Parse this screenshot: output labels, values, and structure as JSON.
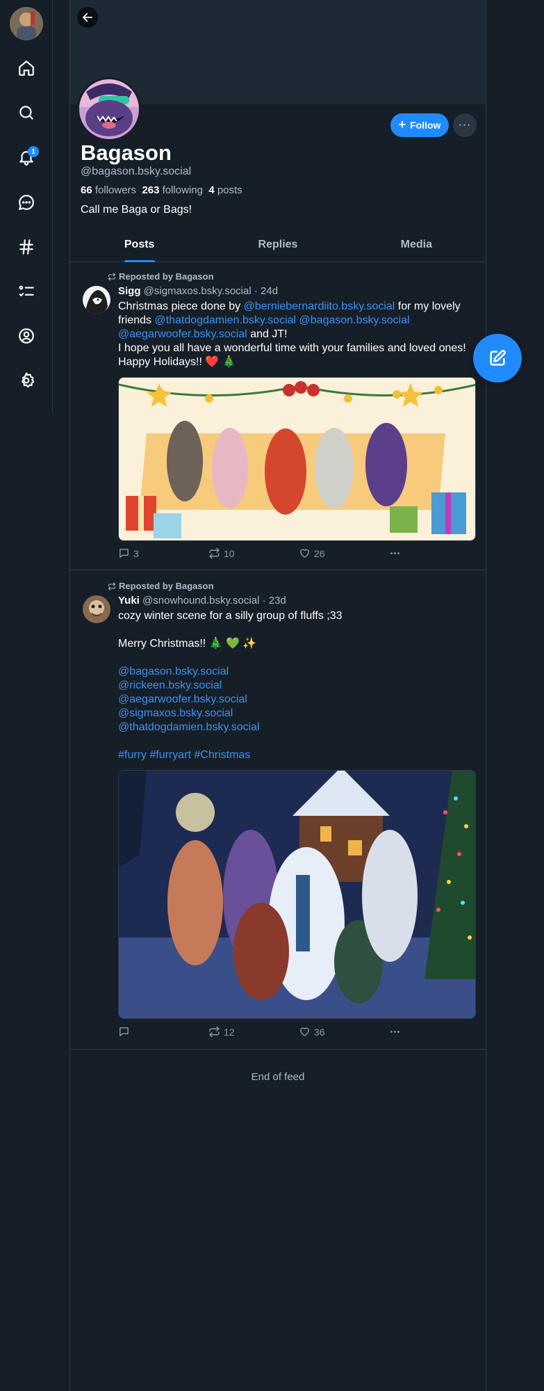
{
  "nav": {
    "items": [
      {
        "name": "home",
        "icon": "home-icon"
      },
      {
        "name": "search",
        "icon": "search-icon"
      },
      {
        "name": "notifications",
        "icon": "bell-icon",
        "badge": "1"
      },
      {
        "name": "chat",
        "icon": "chat-icon"
      },
      {
        "name": "feeds",
        "icon": "hashtag-icon"
      },
      {
        "name": "lists",
        "icon": "list-icon"
      },
      {
        "name": "profile",
        "icon": "user-icon"
      },
      {
        "name": "settings",
        "icon": "gear-icon"
      }
    ]
  },
  "profile": {
    "display_name": "Bagason",
    "handle": "@bagason.bsky.social",
    "followers_count": "66",
    "followers_label": "followers",
    "following_count": "263",
    "following_label": "following",
    "posts_count": "4",
    "posts_label": "posts",
    "bio": "Call me Baga or Bags!",
    "follow_label": "Follow",
    "more_label": "···"
  },
  "tabs": [
    {
      "label": "Posts",
      "active": true
    },
    {
      "label": "Replies",
      "active": false
    },
    {
      "label": "Media",
      "active": false
    }
  ],
  "posts": [
    {
      "repost_label": "Reposted by Bagason",
      "author": "Sigg",
      "handle": "@sigmaxos.bsky.social",
      "time": "· 24d",
      "text": {
        "l1a": "Christmas piece done by ",
        "l1b": "@berniebernardiito.bsky.social",
        "l1c": " for my lovely",
        "l2a": "friends ",
        "l2b": "@thatdogdamien.bsky.social",
        "l2c": " ",
        "l2d": "@bagason.bsky.social",
        "l3a": "@aegarwoofer.bsky.social",
        "l3b": " and JT!",
        "l4": "I hope you all have a wonderful time with your families and loved ones!",
        "l5": "Happy Holidays!! ❤️ 🎄"
      },
      "replies": "3",
      "reposts": "10",
      "likes": "26"
    },
    {
      "repost_label": "Reposted by Bagason",
      "author": "Yuki",
      "handle": "@snowhound.bsky.social",
      "time": "· 23d",
      "text": {
        "l1": "cozy winter scene for a silly group of fluffs ;33",
        "l2": "Merry Christmas!! 🎄 💚 ✨",
        "m1": "@bagason.bsky.social",
        "m2": "@rickeen.bsky.social",
        "m3": "@aegarwoofer.bsky.social",
        "m4": "@sigmaxos.bsky.social",
        "m5": "@thatdogdamien.bsky.social",
        "t1": "#furry",
        "t2": "#furryart",
        "t3": "#Christmas"
      },
      "replies": "",
      "reposts": "12",
      "likes": "36"
    }
  ],
  "end_of_feed": "End of feed",
  "colors": {
    "accent": "#208bfe",
    "background": "#161e27",
    "link": "#3a93f5"
  }
}
